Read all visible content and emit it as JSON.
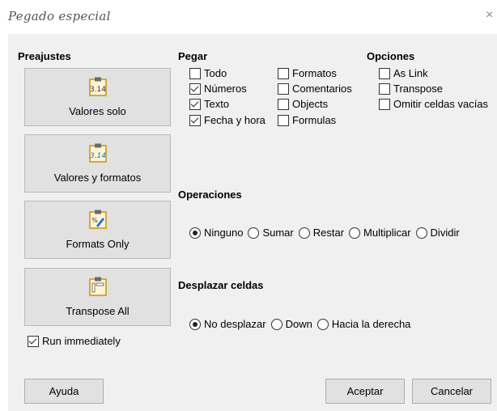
{
  "window": {
    "title": "Pegado especial",
    "close_glyph": "×"
  },
  "presets": {
    "heading": "Preajustes",
    "items": [
      {
        "label": "Valores solo",
        "icon": "paste-values-icon"
      },
      {
        "label": "Valores y formatos",
        "icon": "paste-values-formats-icon"
      },
      {
        "label": "Formats Only",
        "icon": "paste-formats-icon"
      },
      {
        "label": "Transpose All",
        "icon": "paste-transpose-icon"
      }
    ],
    "run_immediately": {
      "label": "Run immediately",
      "checked": true
    }
  },
  "paste": {
    "heading": "Pegar",
    "col1": [
      {
        "label": "Todo",
        "checked": false
      },
      {
        "label": "Números",
        "checked": true
      },
      {
        "label": "Texto",
        "checked": true
      },
      {
        "label": "Fecha y hora",
        "checked": true
      }
    ],
    "col2": [
      {
        "label": "Formatos",
        "checked": false
      },
      {
        "label": "Comentarios",
        "checked": false
      },
      {
        "label": "Objects",
        "checked": false
      },
      {
        "label": "Formulas",
        "checked": false
      }
    ]
  },
  "options": {
    "heading": "Opciones",
    "items": [
      {
        "label": "As Link",
        "checked": false
      },
      {
        "label": "Transpose",
        "checked": false
      },
      {
        "label": "Omitir celdas vacías",
        "checked": false
      }
    ]
  },
  "operations": {
    "heading": "Operaciones",
    "items": [
      {
        "label": "Ninguno",
        "selected": true
      },
      {
        "label": "Sumar",
        "selected": false
      },
      {
        "label": "Restar",
        "selected": false
      },
      {
        "label": "Multiplicar",
        "selected": false
      },
      {
        "label": "Dividir",
        "selected": false
      }
    ]
  },
  "shift": {
    "heading": "Desplazar celdas",
    "items": [
      {
        "label": "No desplazar",
        "selected": true
      },
      {
        "label": "Down",
        "selected": false
      },
      {
        "label": "Hacia la derecha",
        "selected": false
      }
    ]
  },
  "buttons": {
    "help": "Ayuda",
    "ok": "Aceptar",
    "cancel": "Cancelar"
  }
}
